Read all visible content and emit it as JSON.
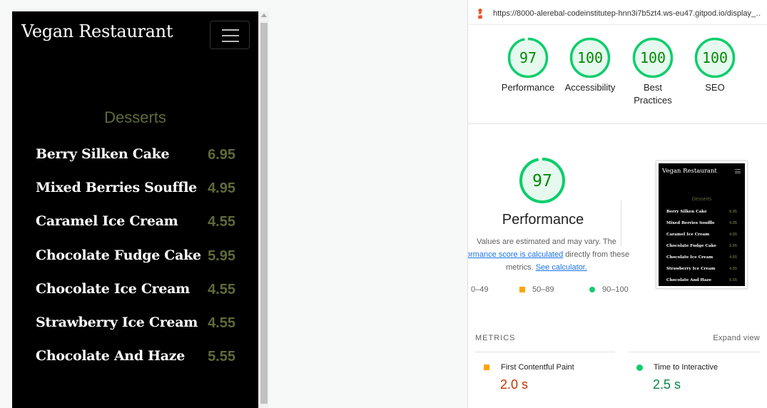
{
  "mobile": {
    "brand": "Vegan Restaurant",
    "section_title": "Desserts",
    "items": [
      {
        "name": "Berry Silken Cake",
        "price": "6.95"
      },
      {
        "name": "Mixed Berries Souffle",
        "price": "4.95"
      },
      {
        "name": "Caramel Ice Cream",
        "price": "4.55"
      },
      {
        "name": "Chocolate Fudge Cake",
        "price": "5.95"
      },
      {
        "name": "Chocolate Ice Cream",
        "price": "4.55"
      },
      {
        "name": "Strawberry Ice Cream",
        "price": "4.55"
      },
      {
        "name": "Chocolate And Haze",
        "price": "5.55"
      }
    ]
  },
  "report": {
    "url": "https://8000-alerebal-codeinstitutep-hnn3i7b5zt4.ws-eu47.gitpod.io/display_…",
    "scores": [
      {
        "value": "97",
        "label": "Performance",
        "fraction": 0.97
      },
      {
        "value": "100",
        "label": "Accessibility",
        "fraction": 1.0
      },
      {
        "value": "100",
        "label": "Best Practices",
        "fraction": 1.0
      },
      {
        "value": "100",
        "label": "SEO",
        "fraction": 1.0
      }
    ],
    "performance": {
      "value": "97",
      "fraction": 0.97,
      "title": "Performance",
      "note_prefix": "Values are estimated and may vary. The",
      "note_link1": "formance score is calculated",
      "note_mid": "directly from these metrics.",
      "note_link2": "See calculator."
    },
    "legend": [
      {
        "range": "0–49",
        "shape": "triangle",
        "color": "#ff4e42"
      },
      {
        "range": "50–89",
        "shape": "square",
        "color": "#ffa400"
      },
      {
        "range": "90–100",
        "shape": "circle",
        "color": "#0cce6b"
      }
    ],
    "thumbnail": {
      "brand": "Vegan Restaurant",
      "section_title": "Desserts",
      "items": [
        {
          "name": "Berry Silken Cake",
          "price": "6.95"
        },
        {
          "name": "Mixed Berries Souffle",
          "price": "4.95"
        },
        {
          "name": "Caramel Ice Cream",
          "price": "4.55"
        },
        {
          "name": "Chocolate Fudge Cake",
          "price": "5.95"
        },
        {
          "name": "Chocolate Ice Cream",
          "price": "4.55"
        },
        {
          "name": "Strawberry Ice Cream",
          "price": "4.55"
        },
        {
          "name": "Chocolate And Haze",
          "price": "5.55"
        }
      ]
    },
    "metrics_heading": "METRICS",
    "expand_label": "Expand view",
    "metrics": [
      {
        "label": "First Contentful Paint",
        "value": "2.0 s",
        "status": "average",
        "color": "#c33300"
      },
      {
        "label": "Time to Interactive",
        "value": "2.5 s",
        "status": "pass",
        "color": "#018642"
      }
    ]
  },
  "colors": {
    "pass_green": "#0cce6b",
    "pass_text": "#008800",
    "pass_fill": "#e6f9ef",
    "average_orange": "#ffa400",
    "accent_olive": "#5e6a3b",
    "link_blue": "#1a73e8"
  }
}
